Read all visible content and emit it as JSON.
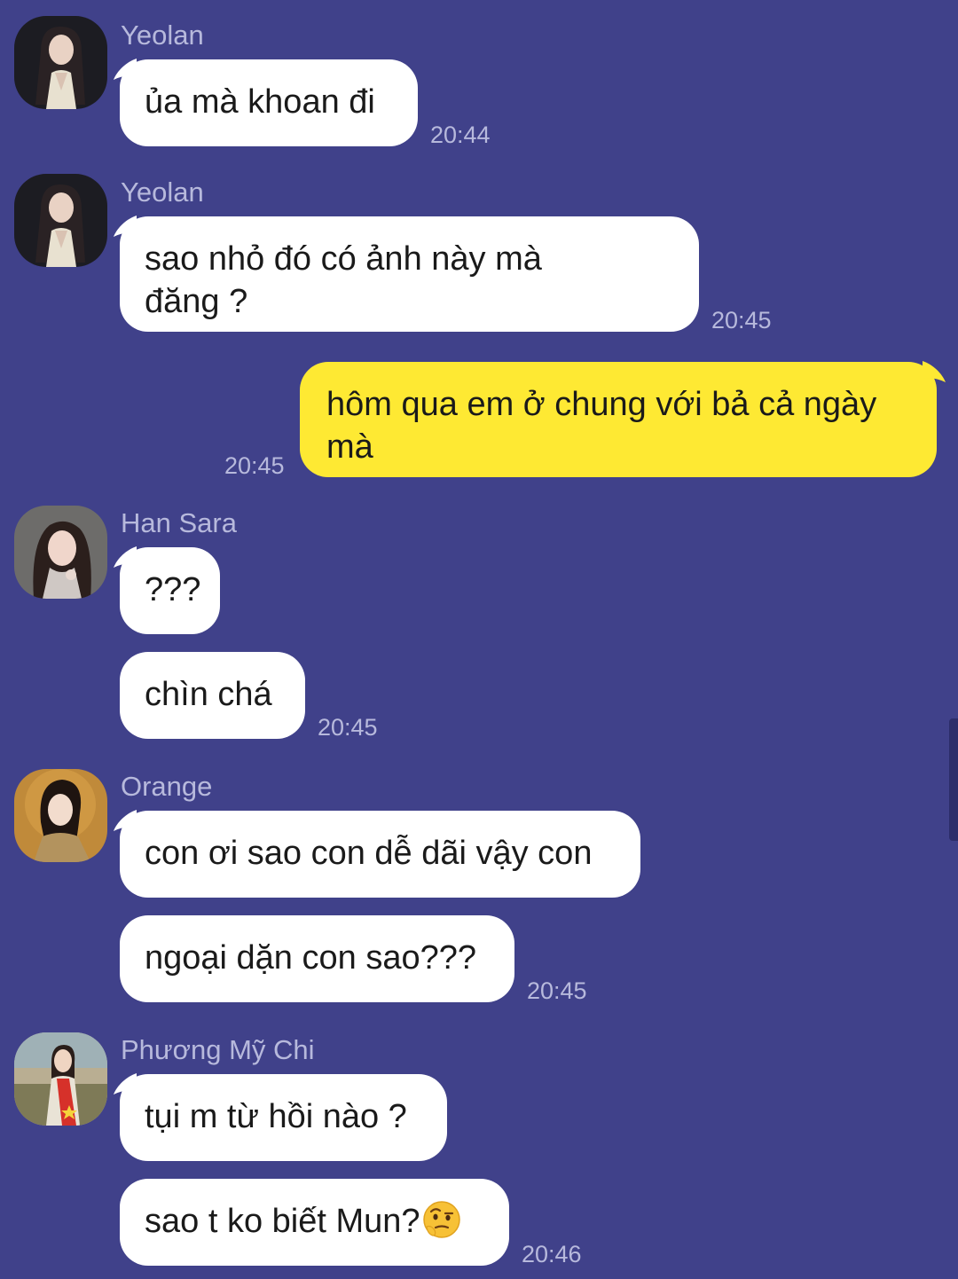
{
  "colors": {
    "background": "#40418a",
    "incoming_bubble": "#ffffff",
    "outgoing_bubble": "#fee933",
    "meta_text": "#b7b9dc"
  },
  "messages": [
    {
      "sender": "Yeolan",
      "avatar": "avatar-yeolan",
      "text": "ủa mà khoan đi",
      "time": "20:44"
    },
    {
      "sender": "Yeolan",
      "avatar": "avatar-yeolan",
      "text": "sao nhỏ đó có ảnh này mà\nđăng ?",
      "time": "20:45"
    },
    {
      "sender": "me",
      "text": "hôm qua em ở chung với bả cả ngày\nmà",
      "time": "20:45"
    },
    {
      "sender": "Han Sara",
      "avatar": "avatar-han-sara",
      "texts": [
        "???",
        "chìn chá"
      ],
      "time": "20:45"
    },
    {
      "sender": "Orange",
      "avatar": "avatar-orange",
      "texts": [
        "con ơi sao con dễ dãi vậy con",
        "ngoại dặn con sao???"
      ],
      "time": "20:45"
    },
    {
      "sender": "Phương Mỹ Chi",
      "avatar": "avatar-phuong-my-chi",
      "texts": [
        "tụi m từ hồi nào ?",
        "sao t ko biết Mun?"
      ],
      "emoji": "raised-eyebrow-emoji",
      "time": "20:46"
    }
  ]
}
